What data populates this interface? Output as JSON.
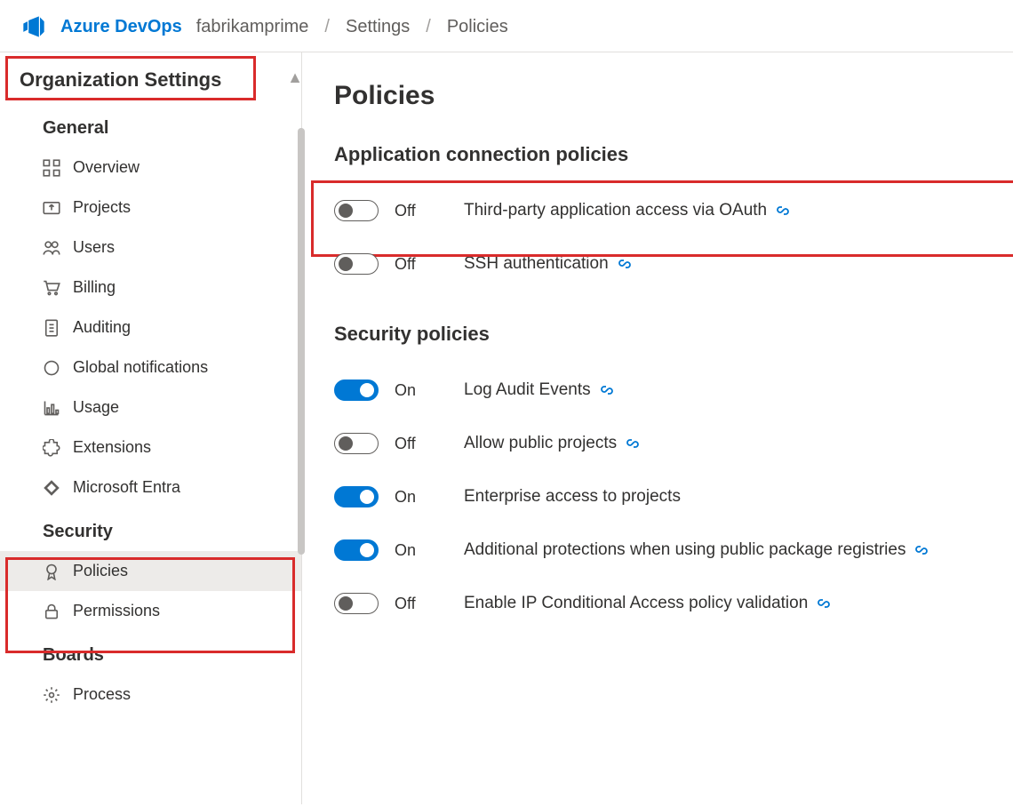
{
  "header": {
    "brand": "Azure DevOps",
    "breadcrumb": [
      "fabrikamprime",
      "Settings",
      "Policies"
    ]
  },
  "sidebar": {
    "title": "Organization Settings",
    "sections": [
      {
        "name": "General",
        "items": [
          {
            "label": "Overview",
            "icon": "grid"
          },
          {
            "label": "Projects",
            "icon": "upload"
          },
          {
            "label": "Users",
            "icon": "users"
          },
          {
            "label": "Billing",
            "icon": "cart"
          },
          {
            "label": "Auditing",
            "icon": "notebook"
          },
          {
            "label": "Global notifications",
            "icon": "chat"
          },
          {
            "label": "Usage",
            "icon": "chart"
          },
          {
            "label": "Extensions",
            "icon": "puzzle"
          },
          {
            "label": "Microsoft Entra",
            "icon": "diamond"
          }
        ]
      },
      {
        "name": "Security",
        "items": [
          {
            "label": "Policies",
            "icon": "badge",
            "selected": true
          },
          {
            "label": "Permissions",
            "icon": "lock"
          }
        ]
      },
      {
        "name": "Boards",
        "items": [
          {
            "label": "Process",
            "icon": "gear"
          }
        ]
      }
    ]
  },
  "main": {
    "title": "Policies",
    "sections": [
      {
        "title": "Application connection policies",
        "policies": [
          {
            "state": "off",
            "stateLabel": "Off",
            "label": "Third-party application access via OAuth",
            "hasLink": true,
            "highlight": true
          },
          {
            "state": "off",
            "stateLabel": "Off",
            "label": "SSH authentication",
            "hasLink": true
          }
        ]
      },
      {
        "title": "Security policies",
        "policies": [
          {
            "state": "on",
            "stateLabel": "On",
            "label": "Log Audit Events",
            "hasLink": true
          },
          {
            "state": "off",
            "stateLabel": "Off",
            "label": "Allow public projects",
            "hasLink": true
          },
          {
            "state": "on",
            "stateLabel": "On",
            "label": "Enterprise access to projects",
            "hasLink": false
          },
          {
            "state": "on",
            "stateLabel": "On",
            "label": "Additional protections when using public package registries",
            "hasLink": true
          },
          {
            "state": "off",
            "stateLabel": "Off",
            "label": "Enable IP Conditional Access policy validation",
            "hasLink": true
          }
        ]
      }
    ]
  }
}
